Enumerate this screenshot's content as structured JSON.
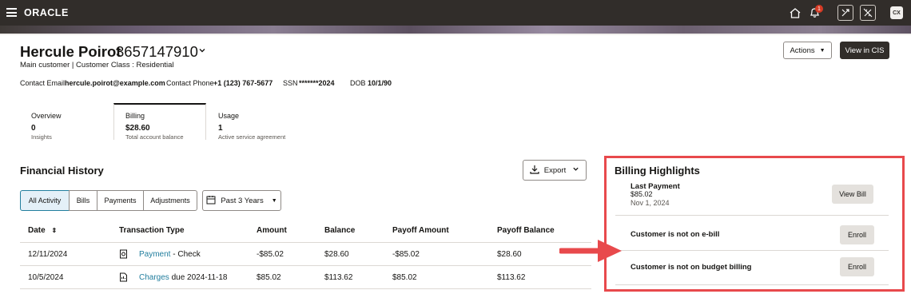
{
  "topbar": {
    "logo": "ORACLE",
    "notification_count": "1",
    "avatar_initials": "CX"
  },
  "customer": {
    "name": "Hercule Poirot",
    "account_id": "3657147910",
    "subtitle": "Main customer | Customer Class : Residential",
    "contact_email_label": "Contact Email",
    "contact_email": "hercule.poirot@example.com",
    "contact_phone_label": "Contact Phone",
    "contact_phone": "+1 (123) 767-5677",
    "ssn_label": "SSN",
    "ssn": "*******2024",
    "dob_label": "DOB",
    "dob": "10/1/90"
  },
  "header_actions": {
    "actions_label": "Actions",
    "view_cis_label": "View in CIS"
  },
  "cards": [
    {
      "title": "Overview",
      "value": "0",
      "sub": "Insights"
    },
    {
      "title": "Billing",
      "value": "$28.60",
      "sub": "Total account balance"
    },
    {
      "title": "Usage",
      "value": "1",
      "sub": "Active service agreement"
    }
  ],
  "financial_history": {
    "title": "Financial History",
    "export_label": "Export",
    "filters": [
      "All Activity",
      "Bills",
      "Payments",
      "Adjustments"
    ],
    "period_label": "Past 3 Years",
    "columns": [
      "Date",
      "Transaction Type",
      "Amount",
      "Balance",
      "Payoff Amount",
      "Payoff Balance"
    ],
    "rows": [
      {
        "date": "12/11/2024",
        "type_link": "Payment",
        "type_rest": " - Check",
        "amount": "-$85.02",
        "balance": "$28.60",
        "payoff_amount": "-$85.02",
        "payoff_balance": "$28.60"
      },
      {
        "date": "10/5/2024",
        "type_link": "Charges",
        "type_rest": " due 2024-11-18",
        "amount": "$85.02",
        "balance": "$113.62",
        "payoff_amount": "$85.02",
        "payoff_balance": "$113.62"
      }
    ]
  },
  "billing_highlights": {
    "title": "Billing Highlights",
    "last_payment_label": "Last Payment",
    "last_payment_amount": "$85.02",
    "last_payment_date": "Nov 1, 2024",
    "view_bill_label": "View Bill",
    "ebill_text": "Customer is not on e-bill",
    "budget_text": "Customer is not on budget billing",
    "enroll_label": "Enroll"
  },
  "colors": {
    "topbar": "#312d2a",
    "link": "#227e9e",
    "highlight_border": "#e8494c",
    "arrow": "#e8494c"
  }
}
